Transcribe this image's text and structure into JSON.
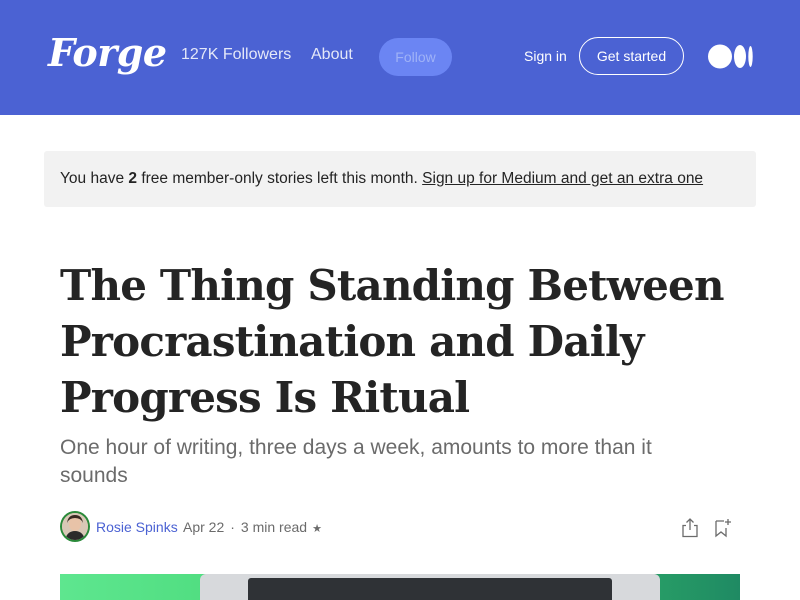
{
  "header": {
    "logo_text": "Forge",
    "followers": "127K Followers",
    "about": "About",
    "follow": "Follow",
    "sign_in": "Sign in",
    "get_started": "Get started",
    "bg_color": "#4b62d3"
  },
  "banner": {
    "prefix": "You have ",
    "count": "2",
    "suffix": " free member-only stories left this month. ",
    "link": "Sign up for Medium and get an extra one"
  },
  "article": {
    "title": "The Thing Standing Between Procrastination and Daily Progress Is Ritual",
    "subtitle": "One hour of writing, three days a week, amounts to more than it sounds",
    "author": "Rosie Spinks",
    "date": "Apr 22",
    "read_time": "3 min read",
    "member_star": "★"
  },
  "icons": {
    "share": "share-icon",
    "bookmark": "bookmark-icon",
    "medium_logo": "medium-logo-icon"
  }
}
